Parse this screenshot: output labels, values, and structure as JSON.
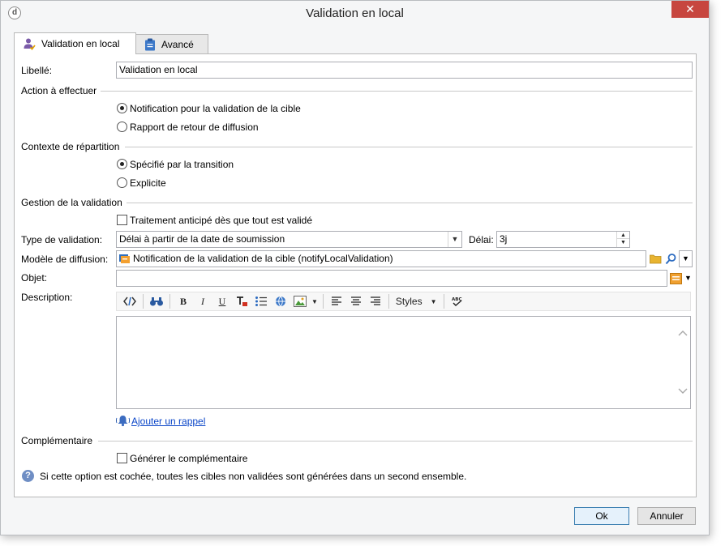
{
  "window": {
    "title": "Validation en local",
    "close_glyph": "✕"
  },
  "tabs": [
    {
      "label": "Validation en local",
      "icon": "user-check-icon"
    },
    {
      "label": "Avancé",
      "icon": "clipboard-icon"
    }
  ],
  "form": {
    "libelle": {
      "label": "Libellé:",
      "value": "Validation en local"
    },
    "action": {
      "section": "Action à effectuer",
      "options": [
        {
          "label": "Notification pour la validation de la cible",
          "checked": true
        },
        {
          "label": "Rapport de retour de diffusion",
          "checked": false
        }
      ]
    },
    "contexte": {
      "section": "Contexte de répartition",
      "options": [
        {
          "label": "Spécifié par la transition",
          "checked": true
        },
        {
          "label": "Explicite",
          "checked": false
        }
      ]
    },
    "gestion": {
      "section": "Gestion de la validation",
      "checkbox_label": "Traitement anticipé dès que tout est validé",
      "checkbox_checked": false
    },
    "type_validation": {
      "label": "Type de validation:",
      "value": "Délai à partir de la date de soumission"
    },
    "delai": {
      "label": "Délai:",
      "value": "3j"
    },
    "modele": {
      "label": "Modèle de diffusion:",
      "value": "Notification de la validation de la cible (notifyLocalValidation)"
    },
    "objet": {
      "label": "Objet:",
      "value": ""
    },
    "description": {
      "label": "Description:"
    },
    "toolbar": {
      "styles_label": "Styles"
    },
    "reminder_link": "Ajouter un rappel",
    "complementaire": {
      "section": "Complémentaire",
      "checkbox_label": "Générer le complémentaire",
      "checkbox_checked": false
    },
    "help_text": "Si cette option est cochée, toutes les cibles non validées sont générées dans un second ensemble."
  },
  "buttons": {
    "ok": "Ok",
    "cancel": "Annuler"
  },
  "colors": {
    "accent": "#3c7fb1",
    "link": "#0b46c8",
    "close": "#c7463f"
  }
}
